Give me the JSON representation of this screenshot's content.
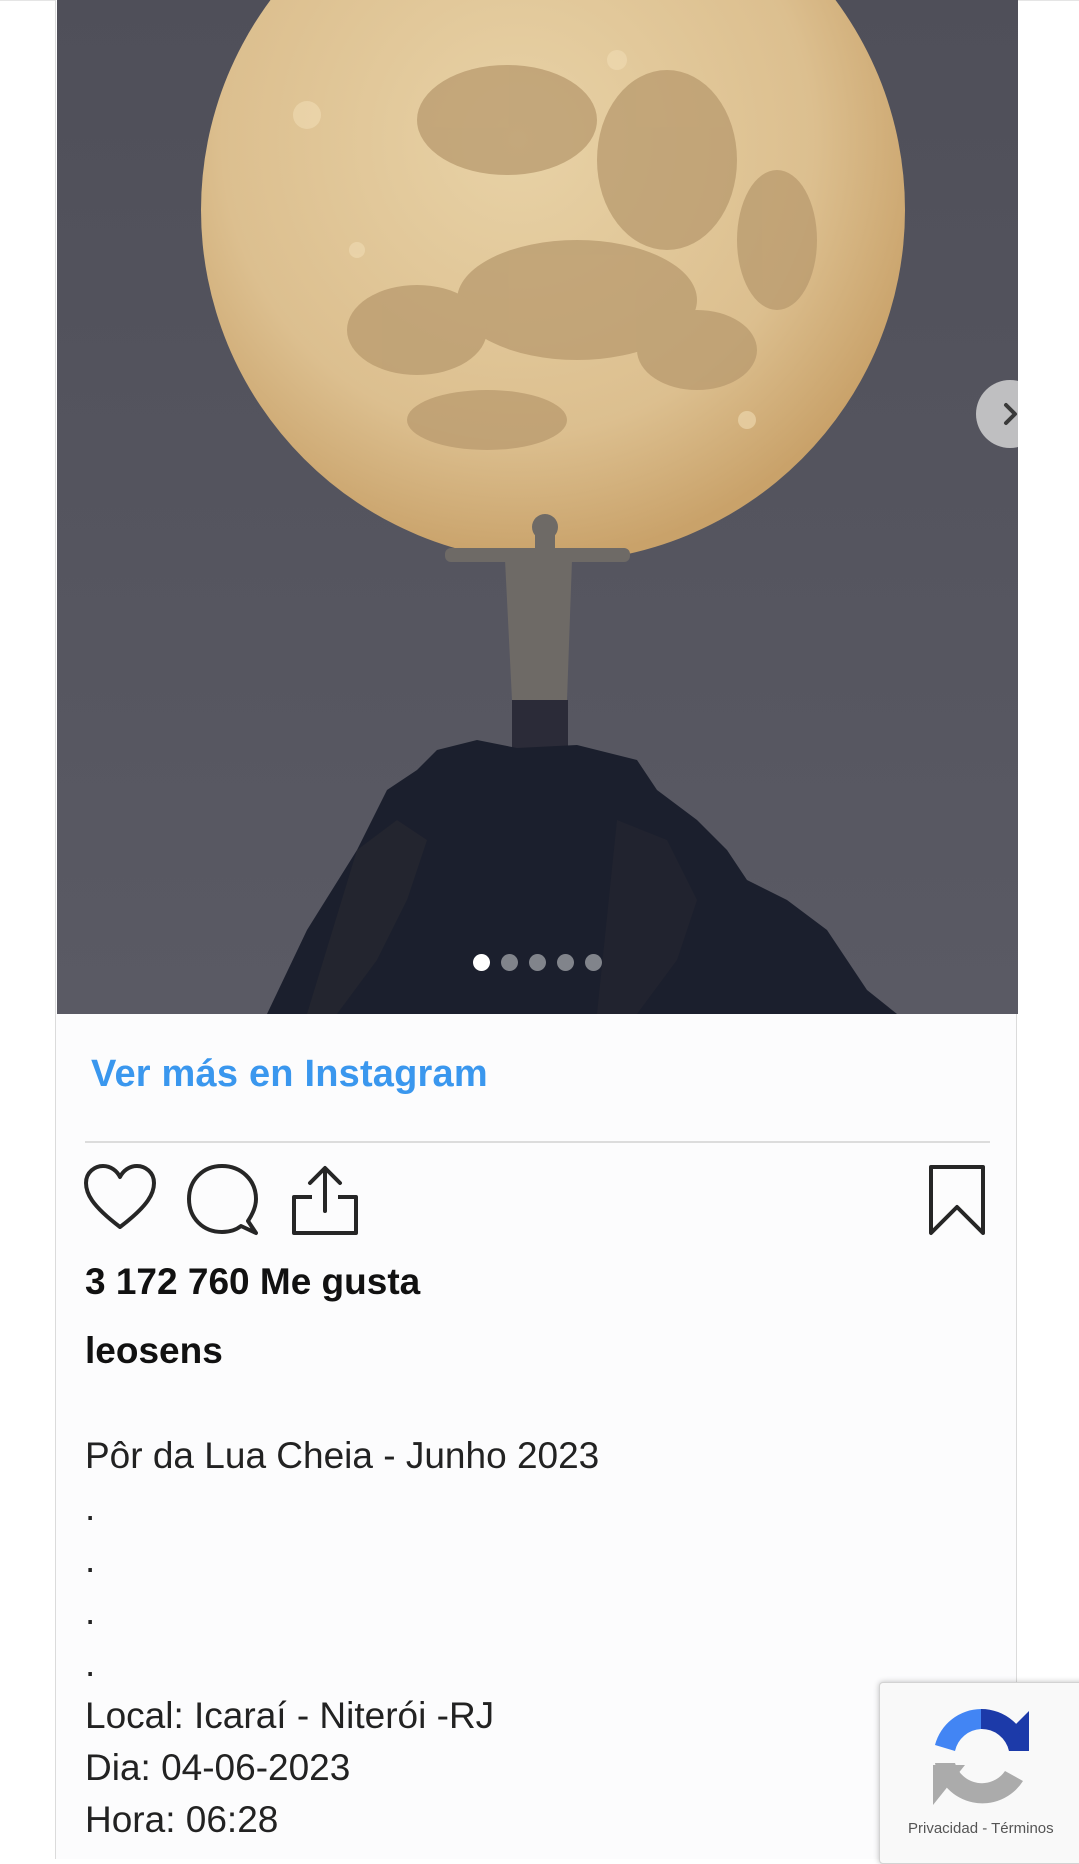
{
  "carousel": {
    "slide_count": 5,
    "active_index": 0,
    "next_icon": "chevron-right-icon"
  },
  "post": {
    "see_more_link": "Ver más en Instagram",
    "likes": "3 172 760 Me gusta",
    "username": "leosens",
    "caption_lines": [
      "Pôr da Lua Cheia - Junho 2023",
      ".",
      ".",
      ".",
      ".",
      "Local: Icaraí - Niterói -RJ",
      "Dia: 04-06-2023",
      "Hora: 06:28"
    ],
    "action_icons": [
      "heart-icon",
      "comment-icon",
      "share-icon",
      "bookmark-icon"
    ]
  },
  "recaptcha": {
    "privacy": "Privacidad",
    "separator": "-",
    "terms": "Términos"
  },
  "colors": {
    "link": "#3a97ee",
    "sky": "#55555f",
    "moon": "#dcbf8f"
  }
}
